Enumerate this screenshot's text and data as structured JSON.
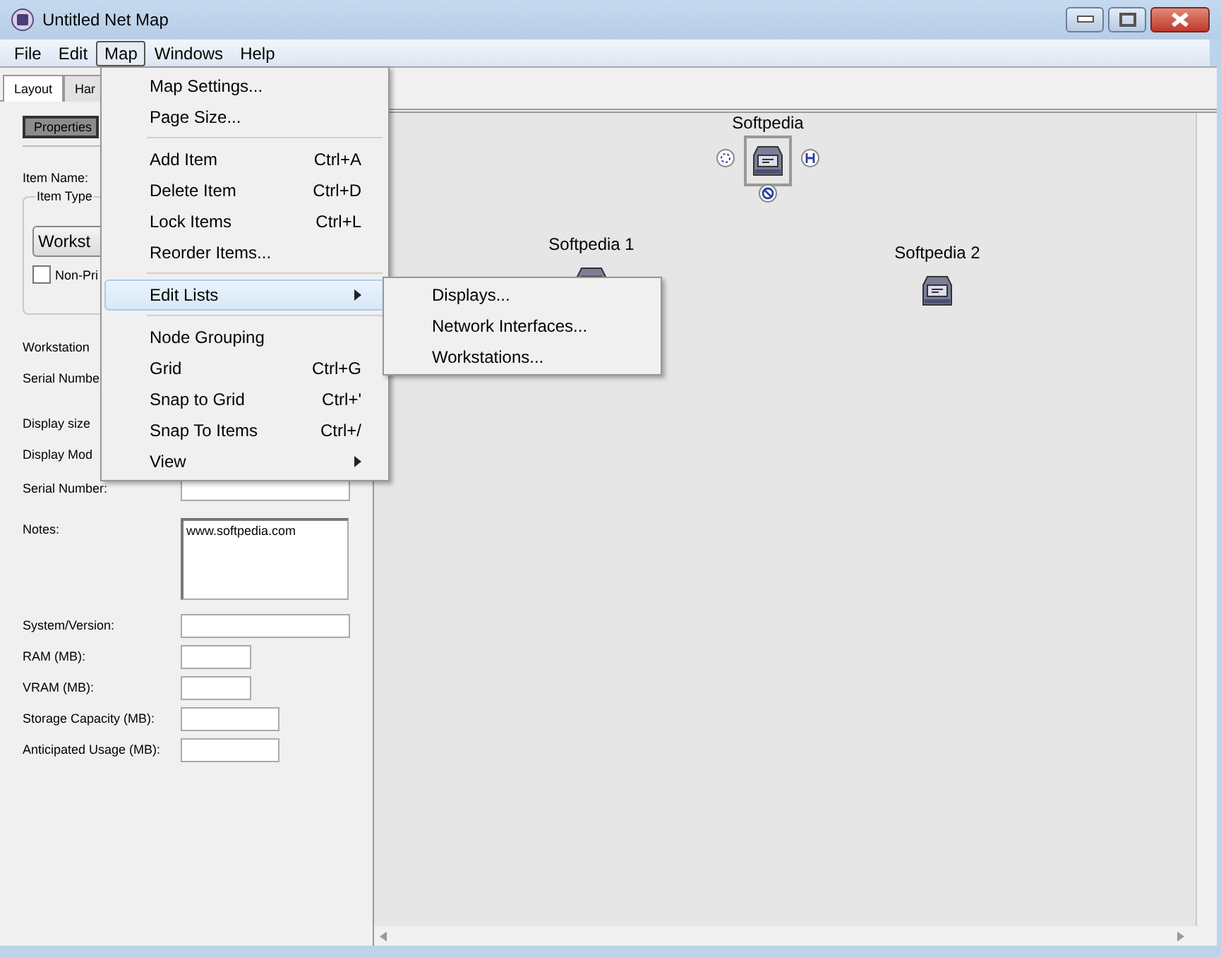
{
  "window": {
    "title": "Untitled Net Map"
  },
  "menubar": [
    {
      "label": "File",
      "selected": false
    },
    {
      "label": "Edit",
      "selected": false
    },
    {
      "label": "Map",
      "selected": true
    },
    {
      "label": "Windows",
      "selected": false
    },
    {
      "label": "Help",
      "selected": false
    }
  ],
  "tabs": [
    {
      "label": "Layout",
      "selected": true
    },
    {
      "label": "Har",
      "selected": false
    }
  ],
  "panel": {
    "properties_button": "Properties",
    "item_name_label": "Item Name:",
    "item_type_label": "Item Type",
    "item_type_value": "Workst",
    "non_primary": {
      "label": "Non-Pri",
      "checked": false
    },
    "labels_top": [
      "Workstation",
      "Serial Numbe",
      "Display size",
      "Display Mod"
    ],
    "fields": [
      {
        "label": "Serial Number:",
        "kind": "wide"
      },
      {
        "label": "Notes:",
        "kind": "notes",
        "value": "www.softpedia.com"
      },
      {
        "label": "System/Version:",
        "kind": "wide"
      },
      {
        "label": "RAM (MB):",
        "kind": "small"
      },
      {
        "label": "VRAM (MB):",
        "kind": "small"
      },
      {
        "label": "Storage Capacity (MB):",
        "kind": "medium"
      },
      {
        "label": "Anticipated Usage (MB):",
        "kind": "medium"
      }
    ]
  },
  "map_menu": [
    {
      "kind": "item",
      "label": "Map Settings...",
      "selected": false
    },
    {
      "kind": "item",
      "label": "Page Size...",
      "selected": false
    },
    {
      "kind": "separator"
    },
    {
      "kind": "item",
      "label": "Add Item",
      "shortcut": "Ctrl+A",
      "selected": false
    },
    {
      "kind": "item",
      "label": "Delete Item",
      "shortcut": "Ctrl+D",
      "selected": false
    },
    {
      "kind": "item",
      "label": "Lock Items",
      "shortcut": "Ctrl+L",
      "selected": false
    },
    {
      "kind": "item",
      "label": "Reorder Items...",
      "selected": false
    },
    {
      "kind": "separator"
    },
    {
      "kind": "submenu",
      "label": "Edit Lists",
      "selected": true
    },
    {
      "kind": "separator"
    },
    {
      "kind": "item",
      "label": "Node Grouping",
      "selected": false
    },
    {
      "kind": "item",
      "label": "Grid",
      "shortcut": "Ctrl+G",
      "selected": false
    },
    {
      "kind": "item",
      "label": "Snap to Grid",
      "shortcut": "Ctrl+'",
      "selected": false
    },
    {
      "kind": "item",
      "label": "Snap To Items",
      "shortcut": "Ctrl+/",
      "selected": false
    },
    {
      "kind": "submenu",
      "label": "View",
      "selected": false
    }
  ],
  "submenu": [
    "Displays...",
    "Network Interfaces...",
    "Workstations..."
  ],
  "nodes": [
    {
      "label": "Softpedia",
      "selected": true
    },
    {
      "label": "Softpedia 1",
      "selected": false
    },
    {
      "label": "Softpedia 2",
      "selected": false
    }
  ]
}
